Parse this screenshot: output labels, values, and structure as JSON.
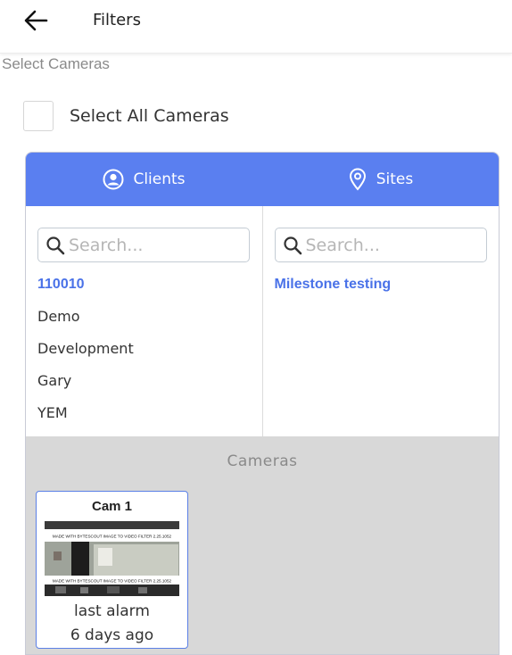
{
  "header": {
    "title": "Filters",
    "back_icon": "arrow-left-icon"
  },
  "section_label": "Select Cameras",
  "select_all": {
    "label": "Select All Cameras",
    "checked": false
  },
  "tabs": [
    {
      "label": "Clients",
      "icon": "user-circle-icon"
    },
    {
      "label": "Sites",
      "icon": "location-pin-icon"
    }
  ],
  "clients": {
    "search_placeholder": "Search...",
    "items": [
      "110010",
      "Demo",
      "Development",
      "Gary",
      "YEM"
    ],
    "selected": "110010"
  },
  "sites": {
    "search_placeholder": "Search...",
    "items": [
      "Milestone testing"
    ],
    "selected": "Milestone testing"
  },
  "cameras": {
    "title": "Cameras",
    "items": [
      {
        "name": "Cam 1",
        "watermark": "MADE WITH BYTESCOUT IMAGE TO VIDEO FILTER 2.25.1052",
        "caption_line1": "last alarm",
        "caption_line2": "6 days ago"
      }
    ]
  },
  "colors": {
    "accent": "#5a7ff0",
    "link": "#4a72e8",
    "cameras_bg": "#d8d8d8"
  }
}
